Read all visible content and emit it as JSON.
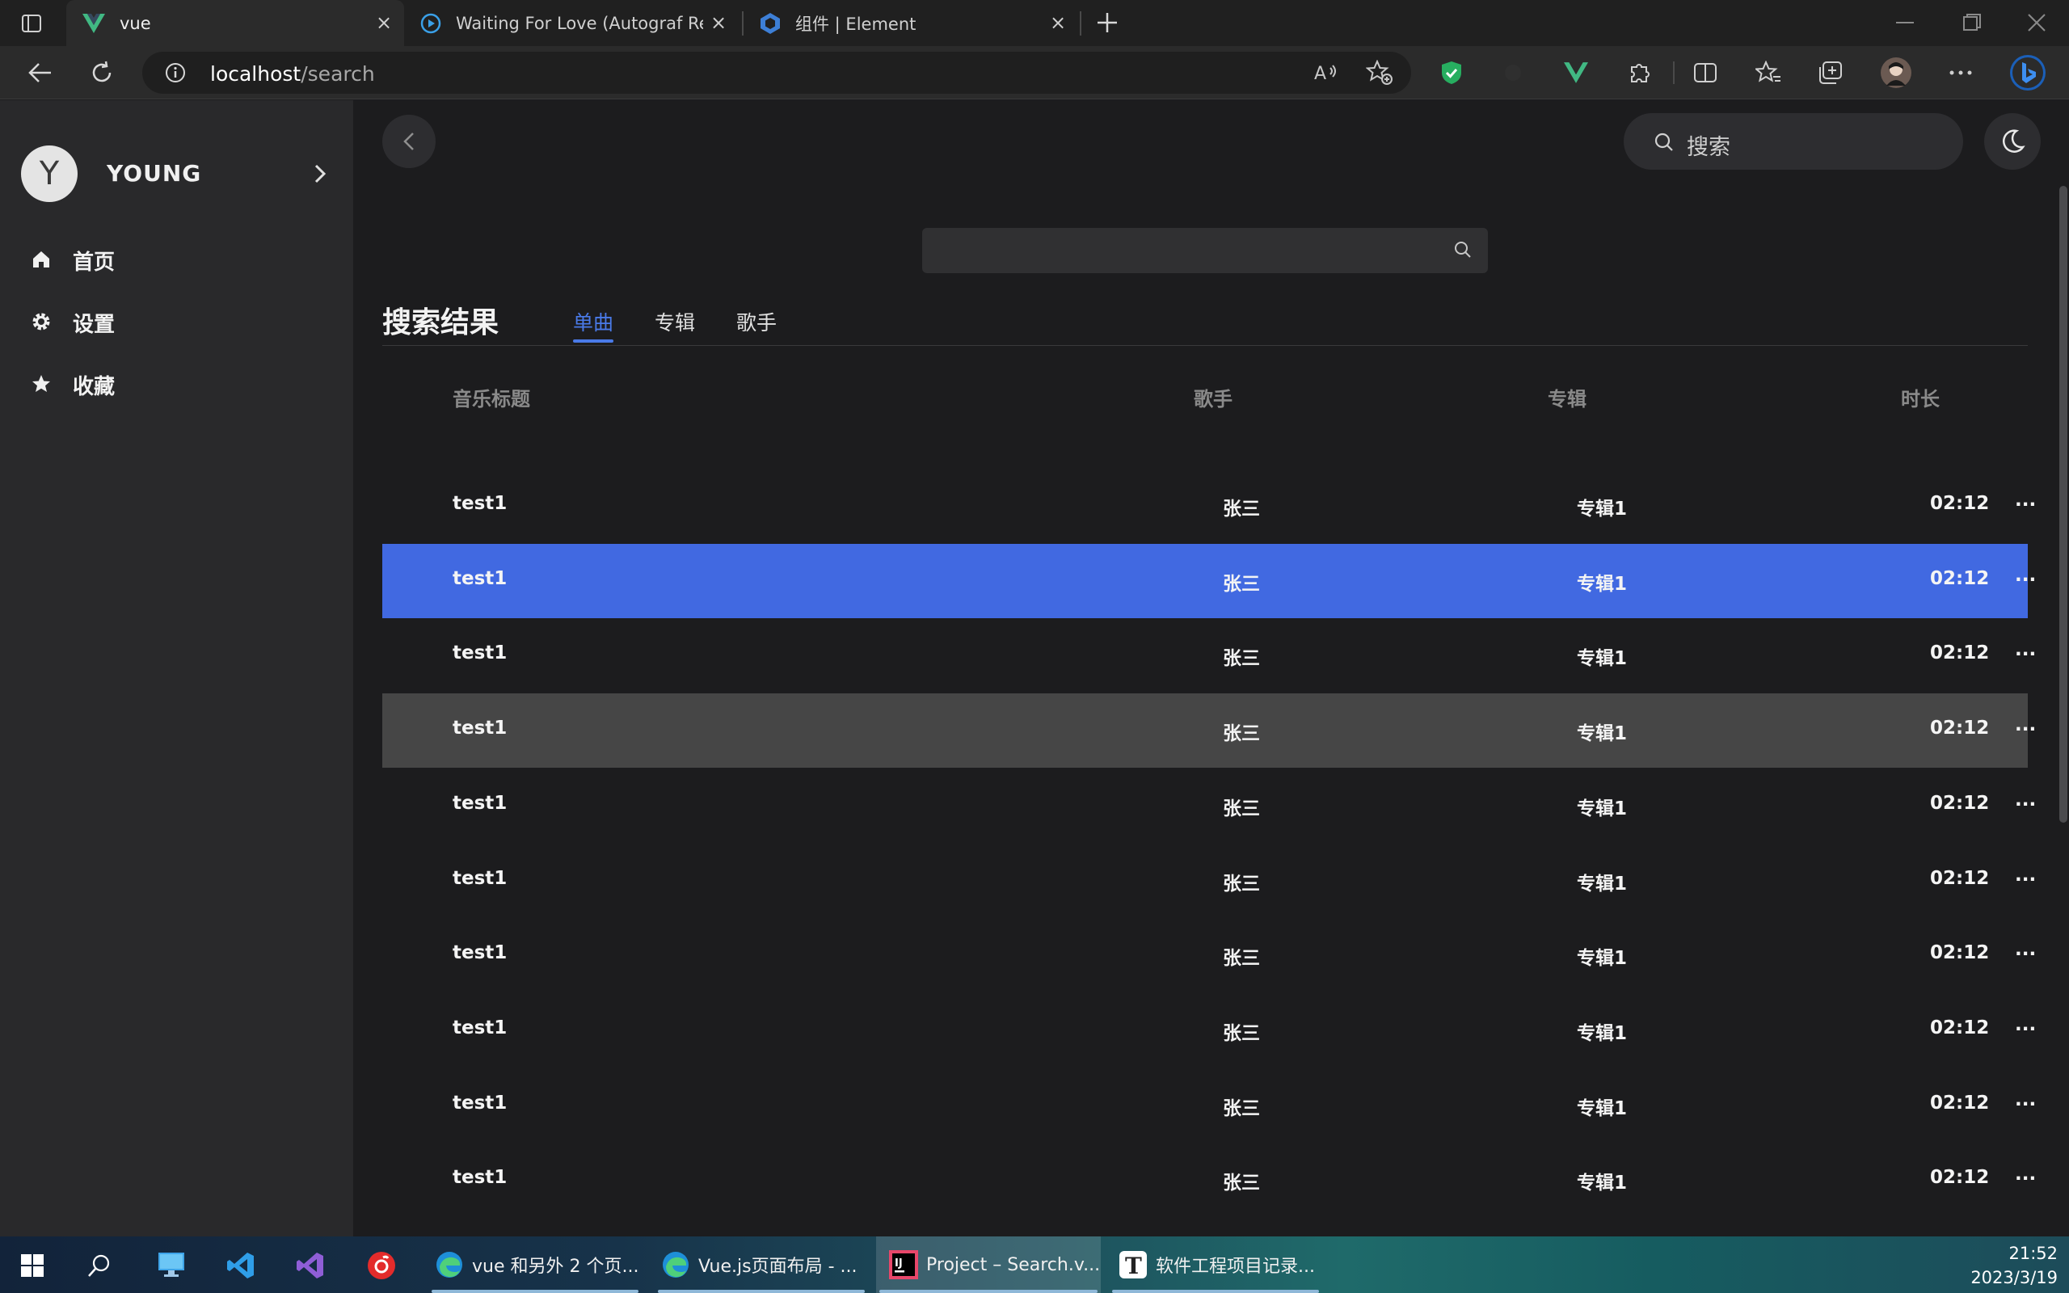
{
  "browser": {
    "tabs": [
      {
        "title": "vue",
        "icon": "vue-logo-icon",
        "active": true
      },
      {
        "title": "Waiting For Love (Autograf Remi",
        "icon": "play-circle-icon",
        "active": false
      },
      {
        "title": "组件 | Element",
        "icon": "element-logo-icon",
        "active": false
      }
    ],
    "address": {
      "host": "localhost",
      "path": "/search"
    }
  },
  "sidebar": {
    "avatar_letter": "Y",
    "username": "YOUNG",
    "nav": [
      {
        "label": "首页",
        "icon": "home-icon"
      },
      {
        "label": "设置",
        "icon": "gear-icon"
      },
      {
        "label": "收藏",
        "icon": "star-icon"
      }
    ]
  },
  "header": {
    "search_placeholder": "搜索"
  },
  "search": {
    "input_value": "",
    "results_title": "搜索结果",
    "tabs": [
      {
        "label": "单曲",
        "active": true
      },
      {
        "label": "专辑",
        "active": false
      },
      {
        "label": "歌手",
        "active": false
      }
    ]
  },
  "table": {
    "headers": {
      "title": "音乐标题",
      "artist": "歌手",
      "album": "专辑",
      "duration": "时长"
    },
    "rows": [
      {
        "title": "test1",
        "artist": "张三",
        "album": "专辑1",
        "duration": "02:12",
        "more": "...",
        "state": ""
      },
      {
        "title": "test1",
        "artist": "张三",
        "album": "专辑1",
        "duration": "02:12",
        "more": "...",
        "state": "playing"
      },
      {
        "title": "test1",
        "artist": "张三",
        "album": "专辑1",
        "duration": "02:12",
        "more": "...",
        "state": ""
      },
      {
        "title": "test1",
        "artist": "张三",
        "album": "专辑1",
        "duration": "02:12",
        "more": "...",
        "state": "hover"
      },
      {
        "title": "test1",
        "artist": "张三",
        "album": "专辑1",
        "duration": "02:12",
        "more": "...",
        "state": ""
      },
      {
        "title": "test1",
        "artist": "张三",
        "album": "专辑1",
        "duration": "02:12",
        "more": "...",
        "state": ""
      },
      {
        "title": "test1",
        "artist": "张三",
        "album": "专辑1",
        "duration": "02:12",
        "more": "...",
        "state": ""
      },
      {
        "title": "test1",
        "artist": "张三",
        "album": "专辑1",
        "duration": "02:12",
        "more": "...",
        "state": ""
      },
      {
        "title": "test1",
        "artist": "张三",
        "album": "专辑1",
        "duration": "02:12",
        "more": "...",
        "state": ""
      },
      {
        "title": "test1",
        "artist": "张三",
        "album": "专辑1",
        "duration": "02:12",
        "more": "...",
        "state": ""
      }
    ]
  },
  "colors": {
    "accent": "#4169e1",
    "tab_active": "#4a7ae8",
    "row_hover": "#464646",
    "sidebar_bg": "#29292b",
    "main_bg": "#1c1c1e"
  },
  "taskbar": {
    "apps": [
      {
        "label": "vue 和另外 2 个页...",
        "icon": "edge-icon"
      },
      {
        "label": "Vue.js页面布局 - ...",
        "icon": "edge-icon"
      },
      {
        "label": "Project – Search.v...",
        "icon": "intellij-icon"
      },
      {
        "label": "软件工程项目记录...",
        "icon": "typora-icon"
      }
    ],
    "time": "21:52",
    "date": "2023/3/19"
  }
}
